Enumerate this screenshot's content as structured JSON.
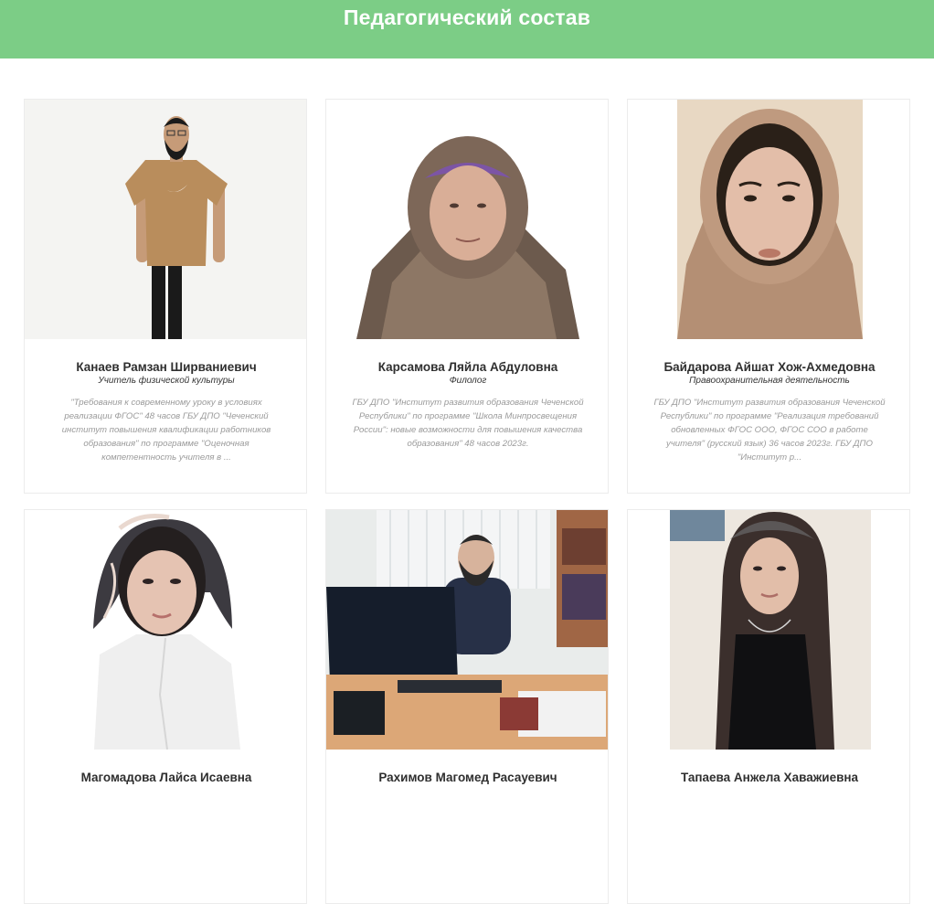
{
  "header": {
    "title": "Педагогический состав",
    "background": "#7ccd86"
  },
  "teachers": [
    {
      "name": "Канаев Рамзан Ширваниевич",
      "role": "Учитель физической культуры",
      "description": "\"Требования к современному уроку в условиях реализации ФГОС\" 48 часов ГБУ ДПО \"Чеченский институт повышения квалификации работников образования\" по программе \"Оценочная компетентность учителя в ..."
    },
    {
      "name": "Карсамова Ляйла Абдуловна",
      "role": "Филолог",
      "description": "ГБУ ДПО \"Институт развития образования Чеченской Республики\" по программе \"Школа Минпросвещения России\": новые возможности для повышения качества образования\" 48 часов 2023г."
    },
    {
      "name": "Байдарова Айшат Хож-Ахмедовна",
      "role": "Правоохранительная деятельность",
      "description": "ГБУ ДПО \"Институт развития образования Чеченской Республики\" по программе \"Реализация требований обновленных ФГОС ООО, ФГОС СОО в работе учителя\" (русский язык) 36 часов 2023г. ГБУ ДПО \"Институт р..."
    },
    {
      "name": "Магомадова Лайса Исаевна",
      "role": "",
      "description": ""
    },
    {
      "name": "Рахимов Магомед Расауевич",
      "role": "",
      "description": ""
    },
    {
      "name": "Тапаева Анжела Хаважиевна",
      "role": "",
      "description": ""
    }
  ]
}
